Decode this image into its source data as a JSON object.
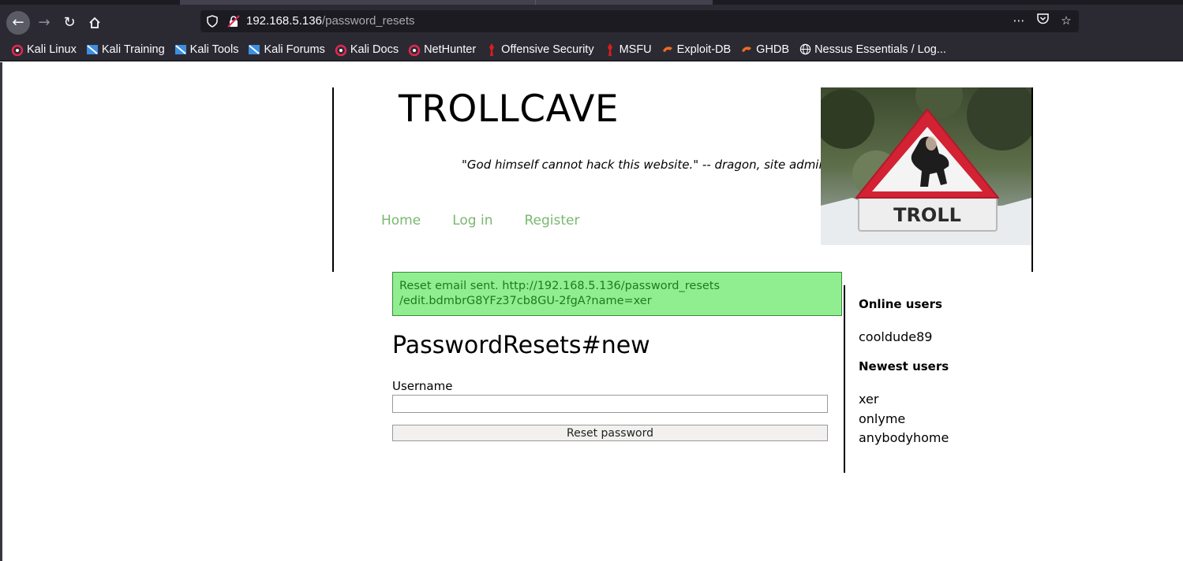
{
  "browser": {
    "url_host": "192.168.5.136",
    "url_path": "/password_resets",
    "bookmarks": [
      {
        "label": "Kali Linux",
        "icon": "kali-dragon-icon"
      },
      {
        "label": "Kali Training",
        "icon": "kali-training-icon"
      },
      {
        "label": "Kali Tools",
        "icon": "kali-tools-icon"
      },
      {
        "label": "Kali Forums",
        "icon": "kali-forums-icon"
      },
      {
        "label": "Kali Docs",
        "icon": "kali-dragon-icon"
      },
      {
        "label": "NetHunter",
        "icon": "kali-dragon-icon"
      },
      {
        "label": "Offensive Security",
        "icon": "offsec-icon"
      },
      {
        "label": "MSFU",
        "icon": "offsec-icon"
      },
      {
        "label": "Exploit-DB",
        "icon": "exploitdb-icon"
      },
      {
        "label": "GHDB",
        "icon": "exploitdb-icon"
      },
      {
        "label": "Nessus Essentials / Log...",
        "icon": "globe-icon"
      }
    ]
  },
  "site": {
    "title": "TROLLCAVE",
    "tagline": "\"God himself cannot hack this website.\" -- dragon, site admin",
    "nav": [
      "Home",
      "Log in",
      "Register"
    ],
    "image_sign_text": "TROLL"
  },
  "flash": {
    "line1": "Reset email sent. http://192.168.5.136/password_resets",
    "line2": "/edit.bdmbrG8YFz37cb8GU-2fgA?name=xer"
  },
  "form": {
    "heading": "PasswordResets#new",
    "username_label": "Username",
    "username_value": "",
    "submit_label": "Reset password"
  },
  "sidebar": {
    "online_heading": "Online users",
    "online_users": [
      "cooldude89"
    ],
    "newest_heading": "Newest users",
    "newest_users": [
      "xer",
      "onlyme",
      "anybodyhome"
    ]
  },
  "colors": {
    "nav_link": "#7ab870",
    "flash_bg": "#90ee90",
    "flash_text": "#1f7a1f",
    "chrome_bg": "#2b2a33"
  }
}
